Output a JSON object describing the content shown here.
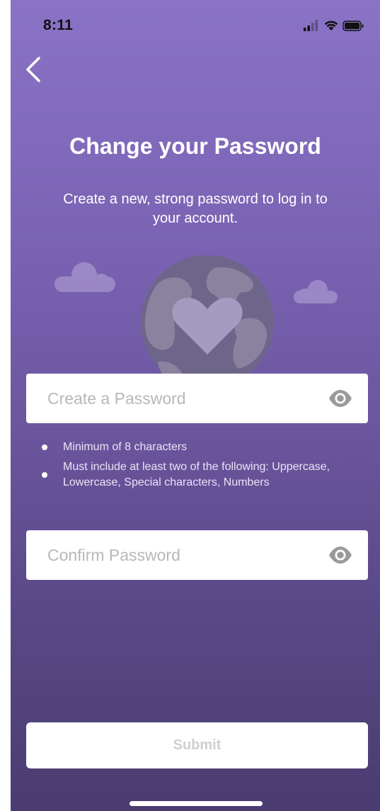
{
  "status_bar": {
    "time": "8:11"
  },
  "header": {
    "back_icon": "chevron-left-icon"
  },
  "main": {
    "title": "Change your Password",
    "subtitle": "Create a new, strong password to log in to your account."
  },
  "illustration": {
    "icon": "globe-heart-icon"
  },
  "password_field": {
    "placeholder": "Create a Password",
    "value": "",
    "toggle_icon": "eye-icon"
  },
  "requirements": [
    {
      "text": "Minimum of 8 characters"
    },
    {
      "text": "Must include at least two of the following: Uppercase, Lowercase, Special characters, Numbers"
    }
  ],
  "confirm_field": {
    "placeholder": "Confirm Password",
    "value": "",
    "toggle_icon": "eye-icon"
  },
  "submit": {
    "label": "Submit",
    "enabled": false
  },
  "colors": {
    "background_top": "#8a73c6",
    "background_bottom": "#4a3c70",
    "submit_text_disabled": "#cfcfcf",
    "placeholder": "#b8b8b8",
    "eye_icon": "#9a9a9a"
  }
}
